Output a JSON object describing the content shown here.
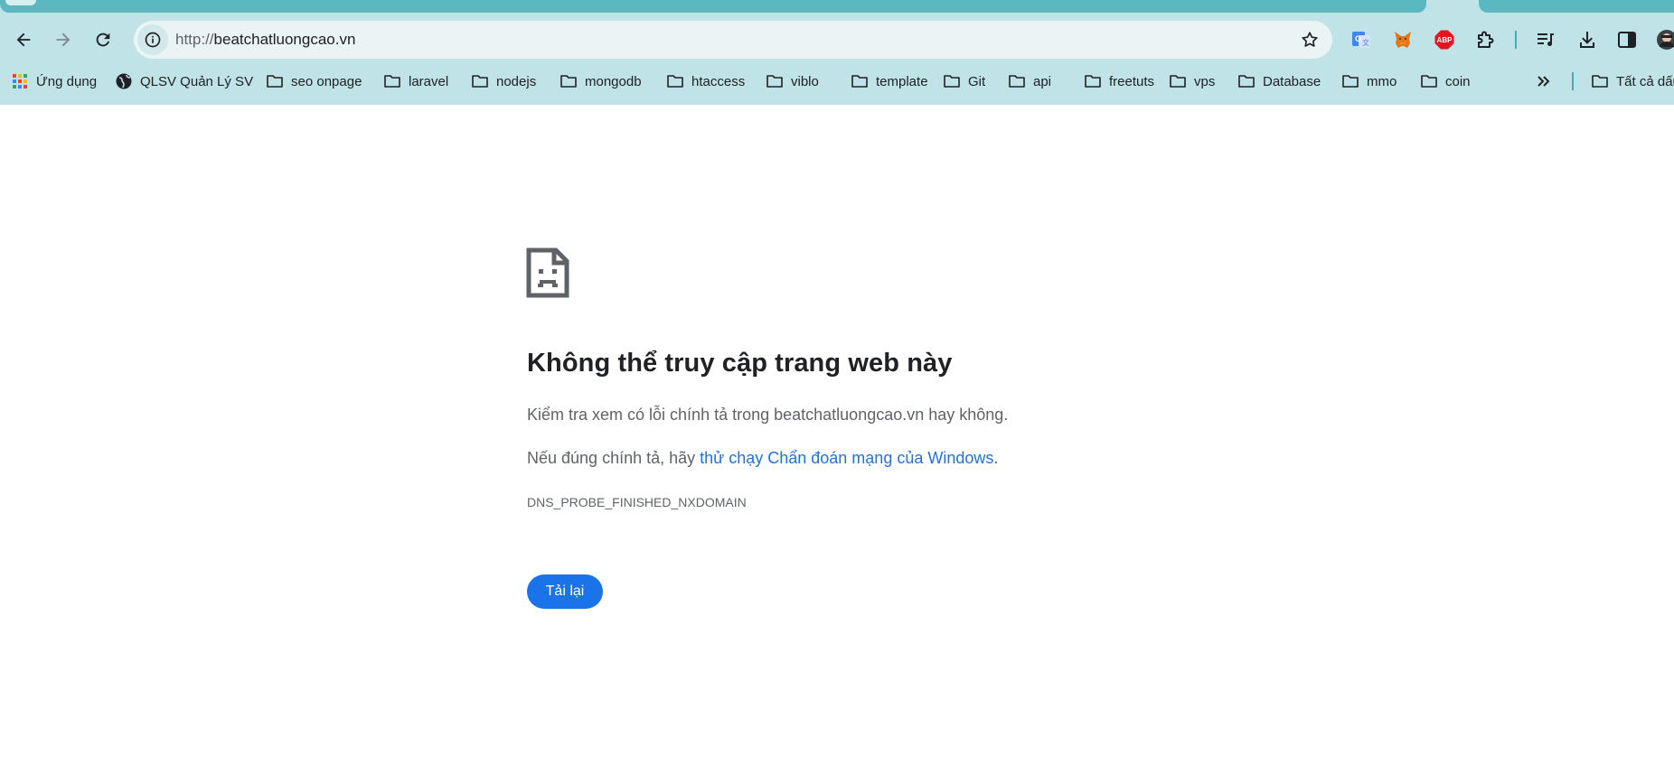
{
  "browser": {
    "address_bar": {
      "scheme": "http://",
      "host": "beatchatluongcao.vn"
    },
    "extensions": [
      {
        "icon": "google-translate-icon"
      },
      {
        "icon": "metamask-fox-icon"
      },
      {
        "icon": "adblock-plus-icon",
        "label": "ABP"
      },
      {
        "icon": "extensions-puzzle-icon"
      },
      {
        "icon": "media-control-icon"
      },
      {
        "icon": "download-icon"
      },
      {
        "icon": "side-panel-icon"
      },
      {
        "icon": "profile-avatar"
      }
    ],
    "bookmarks": [
      {
        "label": "Ứng dụng",
        "icon": "apps-grid-icon"
      },
      {
        "label": "QLSV Quản Lý SV",
        "icon": "globe-icon"
      },
      {
        "label": "seo onpage",
        "icon": "folder-icon"
      },
      {
        "label": "laravel",
        "icon": "folder-icon"
      },
      {
        "label": "nodejs",
        "icon": "folder-icon"
      },
      {
        "label": "mongodb",
        "icon": "folder-icon"
      },
      {
        "label": "htaccess",
        "icon": "folder-icon"
      },
      {
        "label": "viblo",
        "icon": "folder-icon"
      },
      {
        "label": "template",
        "icon": "folder-icon"
      },
      {
        "label": "Git",
        "icon": "folder-icon"
      },
      {
        "label": "api",
        "icon": "folder-icon"
      },
      {
        "label": "freetuts",
        "icon": "folder-icon"
      },
      {
        "label": "vps",
        "icon": "folder-icon"
      },
      {
        "label": "Database",
        "icon": "folder-icon"
      },
      {
        "label": "mmo",
        "icon": "folder-icon"
      },
      {
        "label": "coin",
        "icon": "folder-icon"
      }
    ],
    "bookmarks_overflow_label": "Tất cả dấu trang"
  },
  "error_page": {
    "title": "Không thể truy cập trang web này",
    "line1": "Kiểm tra xem có lỗi chính tả trong beatchatluongcao.vn hay không.",
    "line2_prefix": "Nếu đúng chính tả, hãy ",
    "line2_link": "thử chạy Chẩn đoán mạng của Windows",
    "line2_suffix": ".",
    "error_code": "DNS_PROBE_FINISHED_NXDOMAIN",
    "reload_button": "Tải lại"
  },
  "colors": {
    "chrome_bg": "#bfe3e6",
    "tab_dark": "#5ab8c0",
    "link_blue": "#1a73e8",
    "button_blue": "#1a73e8",
    "text_primary": "#202124",
    "text_secondary": "#5f6368"
  }
}
